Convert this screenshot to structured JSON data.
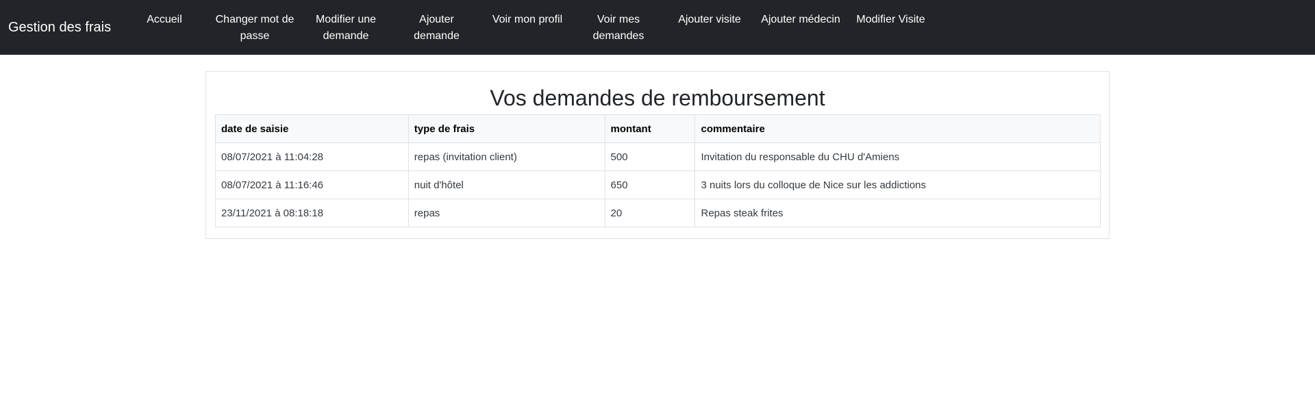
{
  "navbar": {
    "brand": "Gestion des frais",
    "items": [
      {
        "line1": "Accueil",
        "line2": ""
      },
      {
        "line1": "Changer mot de",
        "line2": "passe"
      },
      {
        "line1": "Modifier une",
        "line2": "demande"
      },
      {
        "line1": "Ajouter",
        "line2": "demande"
      },
      {
        "line1": "Voir mon profil",
        "line2": ""
      },
      {
        "line1": "Voir mes",
        "line2": "demandes"
      },
      {
        "line1": "Ajouter visite",
        "line2": ""
      },
      {
        "line1": "Ajouter médecin",
        "line2": ""
      },
      {
        "line1": "Modifier Visite",
        "line2": ""
      }
    ]
  },
  "main": {
    "title": "Vos demandes de remboursement",
    "table": {
      "headers": [
        "date de saisie",
        "type de frais",
        "montant",
        "commentaire"
      ],
      "rows": [
        [
          "08/07/2021 à 11:04:28",
          "repas (invitation client)",
          "500",
          "Invitation du responsable du CHU d'Amiens"
        ],
        [
          "08/07/2021 à 11:16:46",
          "nuit d'hôtel",
          "650",
          "3 nuits lors du colloque de Nice sur les addictions"
        ],
        [
          "23/11/2021 à 08:18:18",
          "repas",
          "20",
          "Repas steak frites"
        ]
      ]
    }
  }
}
